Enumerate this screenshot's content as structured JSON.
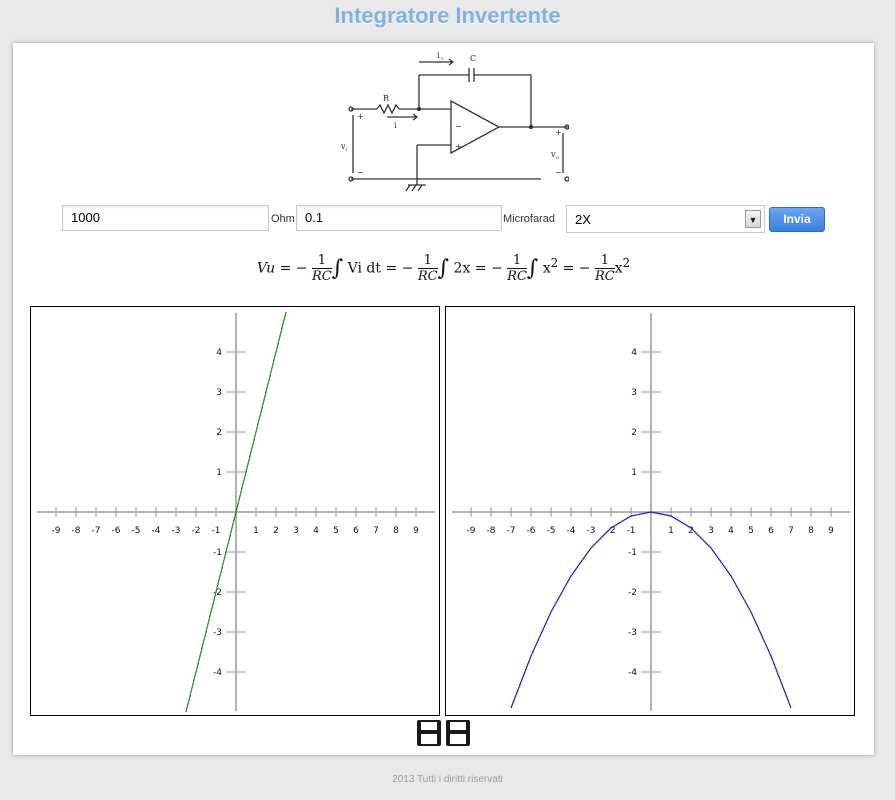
{
  "page": {
    "title": "Integratore Invertente"
  },
  "circuit": {
    "labels": {
      "ic": "i",
      "ic_sub": "c",
      "c": "C",
      "r": "R",
      "i": "i",
      "vi": "v",
      "vi_sub": "i",
      "vo": "v",
      "vo_sub": "o"
    }
  },
  "form": {
    "resistance_value": "1000",
    "resistance_unit": "Ohm",
    "capacitance_value": "0.1",
    "capacitance_unit": "Microfarad",
    "function_selected": "2X",
    "submit_label": "Invia"
  },
  "formula": {
    "lhs": "Vu",
    "eq": "= −",
    "frac_num": "1",
    "frac_den": "RC",
    "integrand_1": "Vi dt",
    "integrand_2": "2x",
    "integrand_3": "x",
    "sup": "2",
    "eq2": "= −",
    "eq3": "= −",
    "eq4": "= −"
  },
  "chart_data": [
    {
      "type": "line",
      "title": "",
      "x_ticks": [
        -9,
        -8,
        -7,
        -6,
        -5,
        -4,
        -3,
        -2,
        -1,
        1,
        2,
        3,
        4,
        5,
        6,
        7,
        8,
        9
      ],
      "y_ticks": [
        -4,
        -3,
        -2,
        -1,
        1,
        2,
        3,
        4
      ],
      "xlim": [
        -10,
        10
      ],
      "ylim": [
        -5,
        5
      ],
      "function": "y = 2x",
      "series": [
        {
          "color": "#1a8a1a",
          "x": [
            -2.5,
            2.5
          ],
          "y": [
            -5,
            5
          ]
        }
      ]
    },
    {
      "type": "line",
      "title": "",
      "x_ticks": [
        -9,
        -8,
        -7,
        -6,
        -5,
        -4,
        -3,
        -2,
        -1,
        1,
        2,
        3,
        4,
        5,
        6,
        7,
        8,
        9
      ],
      "y_ticks": [
        -4,
        -3,
        -2,
        -1,
        1,
        2,
        3,
        4
      ],
      "xlim": [
        -10,
        10
      ],
      "ylim": [
        -5,
        5
      ],
      "function": "y = -x^2/10",
      "series": [
        {
          "color": "#1a1acc",
          "x": [
            -7,
            -6,
            -5,
            -4,
            -3,
            -2,
            -1,
            0,
            1,
            2,
            3,
            4,
            5,
            6,
            7
          ],
          "y": [
            -4.9,
            -3.6,
            -2.5,
            -1.6,
            -0.9,
            -0.4,
            -0.1,
            0,
            -0.1,
            -0.4,
            -0.9,
            -1.6,
            -2.5,
            -3.6,
            -4.9
          ]
        }
      ]
    }
  ],
  "footer": {
    "text": "2013 Tutti i diritti riservati"
  }
}
